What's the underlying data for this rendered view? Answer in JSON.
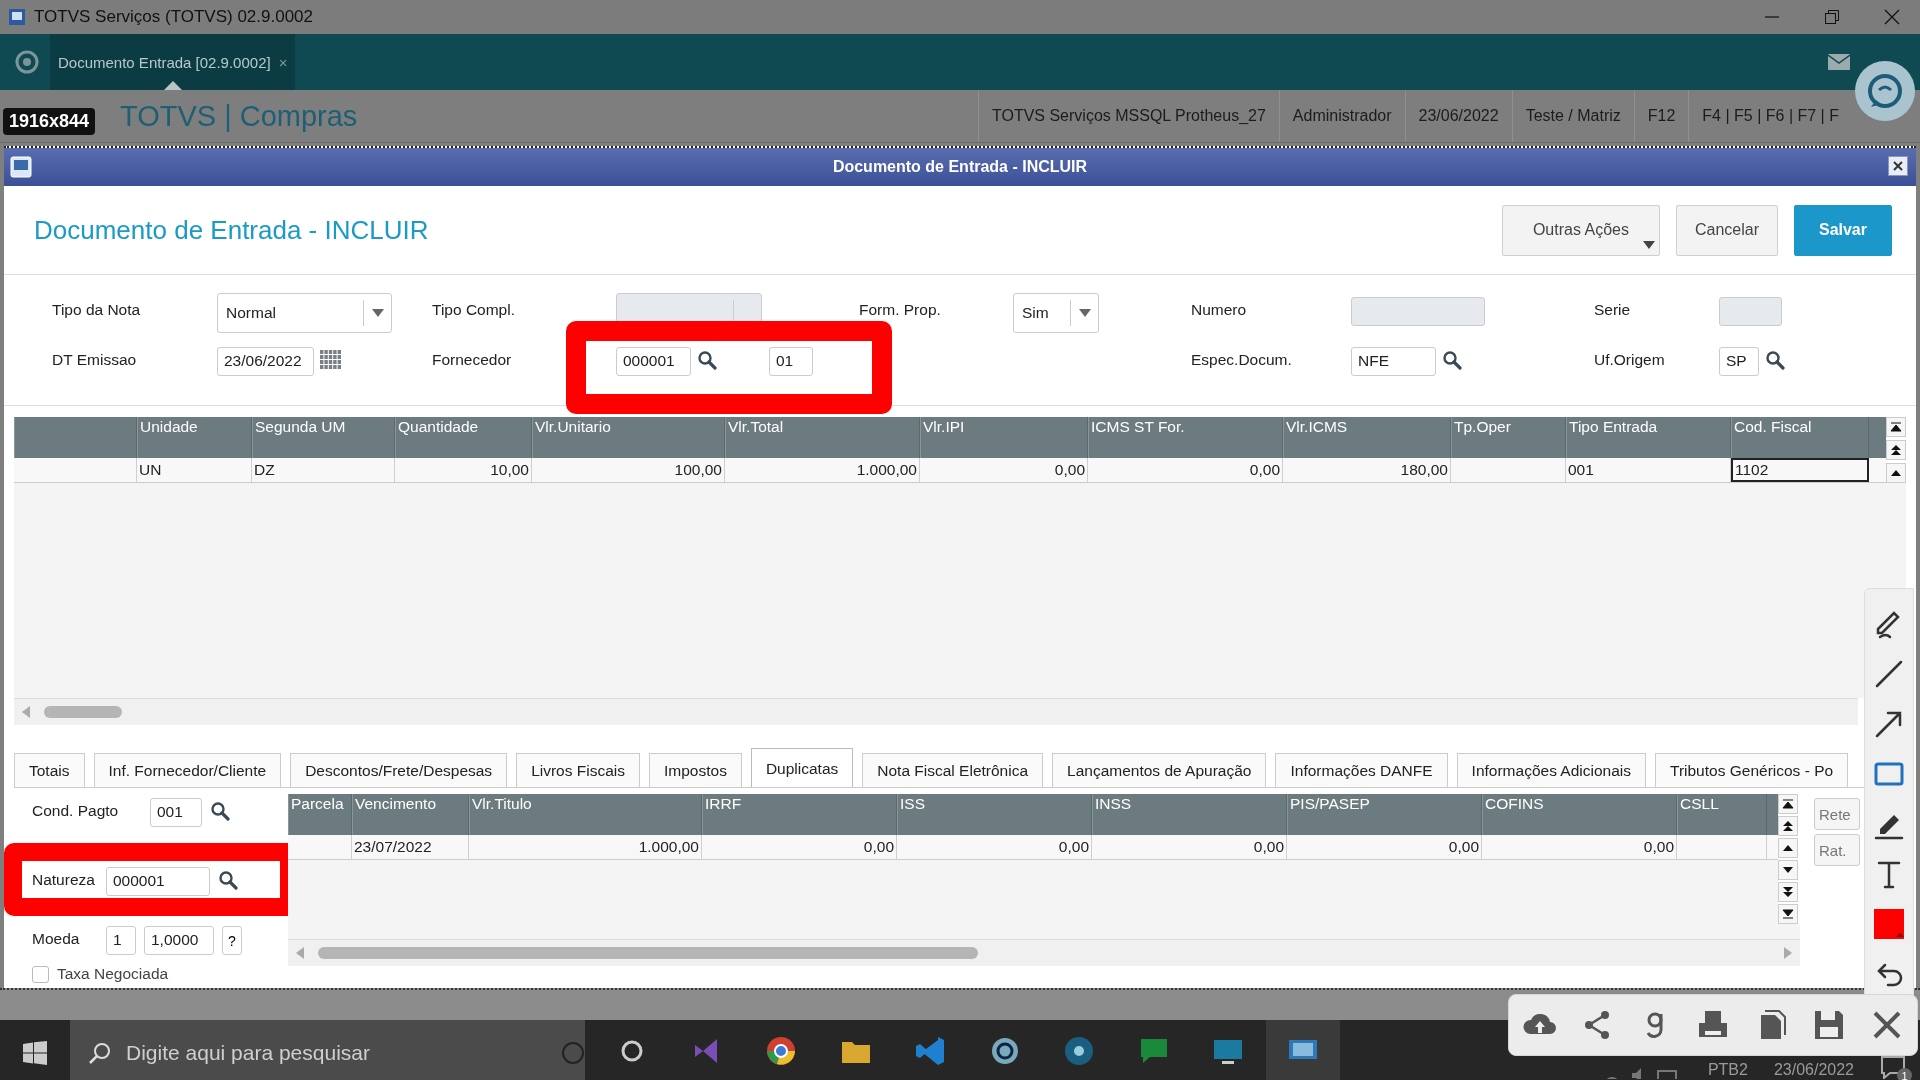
{
  "window": {
    "title": "TOTVS Serviços (TOTVS) 02.9.0002"
  },
  "app_tabs": [
    {
      "label": "Documento Entrada [02.9.0002]",
      "close": "×",
      "selected": true
    }
  ],
  "header": {
    "brand": "TOTVS",
    "separator": "|",
    "module": "Compras",
    "info": [
      "TOTVS Serviços MSSQL Protheus_27",
      "Administrador",
      "23/06/2022",
      "Teste / Matriz",
      "F12",
      "F4 | F5 | F6 | F7 | F"
    ]
  },
  "capture": {
    "size": "1916x844"
  },
  "dialog": {
    "title": "Documento de Entrada - INCLUIR",
    "heading": "Documento de Entrada - INCLUIR",
    "buttons": [
      {
        "label": "Outras Ações",
        "kind": "menu"
      },
      {
        "label": "Cancelar",
        "kind": "default"
      },
      {
        "label": "Salvar",
        "kind": "primary"
      }
    ],
    "fields": [
      [
        {
          "label": "Tipo da Nota",
          "kind": "select",
          "value": "Normal",
          "disabled": false
        },
        {
          "label": "Tipo Compl.",
          "kind": "select",
          "disabled": true
        },
        {
          "label": "Form. Prop.",
          "kind": "select",
          "value": "Sim",
          "disabled": false
        },
        {
          "label": "Numero",
          "kind": "text",
          "disabled": true
        },
        {
          "label": "Serie",
          "kind": "text",
          "disabled": true
        }
      ],
      [
        {
          "label": "DT Emissao",
          "kind": "date",
          "value": "23/06/2022"
        },
        {
          "label": "Fornecedor",
          "kind": "lookup",
          "value": "000001",
          "extra": "01",
          "highlighted": true
        },
        {
          "label": "Espec.Docum.",
          "kind": "lookup",
          "value": "NFE"
        },
        {
          "label": "Uf.Origem",
          "kind": "lookup",
          "value": "SP"
        }
      ]
    ],
    "items_table": {
      "columns": [
        "Unidade",
        "Segunda UM",
        "Quantidade",
        "Vlr.Unitario",
        "Vlr.Total",
        "Vlr.IPI",
        "ICMS ST For.",
        "Vlr.ICMS",
        "Tp.Oper",
        "Tipo Entrada",
        "Cod. Fiscal"
      ],
      "rows": [
        [
          "UN",
          "DZ",
          "10,00",
          "100,00",
          "1.000,00",
          "0,00",
          "0,00",
          "180,00",
          null,
          "001",
          "1102"
        ]
      ]
    },
    "tabs": [
      {
        "label": "Totais",
        "selected": false
      },
      {
        "label": "Inf. Fornecedor/Cliente",
        "selected": false
      },
      {
        "label": "Descontos/Frete/Despesas",
        "selected": false
      },
      {
        "label": "Livros Fiscais",
        "selected": false
      },
      {
        "label": "Impostos",
        "selected": false
      },
      {
        "label": "Duplicatas",
        "selected": true
      },
      {
        "label": "Nota Fiscal Eletrônica",
        "selected": false
      },
      {
        "label": "Lançamentos de Apuração",
        "selected": false
      },
      {
        "label": "Informações DANFE",
        "selected": false
      },
      {
        "label": "Informações Adicionais",
        "selected": false
      },
      {
        "label": "Tributos Genéricos - Po",
        "selected": false
      }
    ],
    "payment": {
      "cond_pagto": {
        "label": "Cond. Pagto",
        "value": "001"
      },
      "natureza": {
        "label": "Natureza",
        "value": "000001",
        "highlighted": true
      },
      "moeda": {
        "label": "Moeda",
        "value": "1",
        "rate": "1,0000",
        "help": "?"
      },
      "taxa_negociada": {
        "label": "Taxa Negociada",
        "checked": false
      }
    },
    "installments_table": {
      "columns": [
        "Parcela",
        "Vencimento",
        "Vlr.Titulo",
        "IRRF",
        "ISS",
        "INSS",
        "PIS/PASEP",
        "COFINS",
        "CSLL"
      ],
      "rows": [
        [
          null,
          "23/07/2022",
          "1.000,00",
          "0,00",
          "0,00",
          "0,00",
          "0,00",
          "0,00",
          null
        ]
      ]
    },
    "side_buttons": [
      "Rete",
      "Rat."
    ]
  },
  "taskbar": {
    "search_placeholder": "Digite aqui para pesquisar",
    "language": "PTB2",
    "date": "23/06/2022",
    "notifications": "1"
  }
}
